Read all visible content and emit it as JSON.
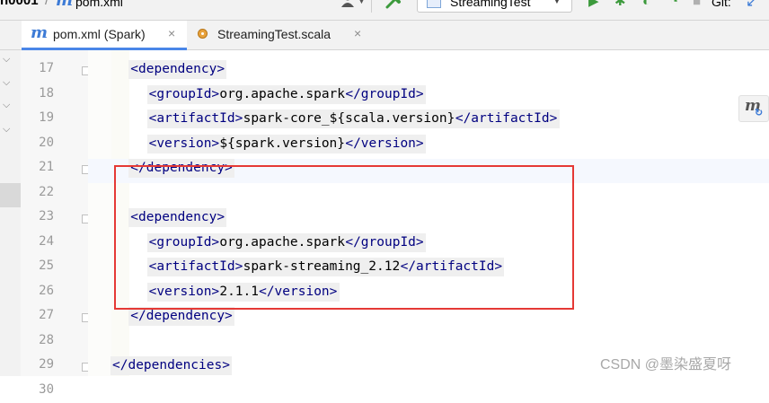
{
  "breadcrumb": {
    "project": "n0001",
    "separator": "/",
    "file": "pom.xml"
  },
  "toolbar": {
    "run_config_label": "StreamingTest",
    "git_label": "Git:"
  },
  "tabs": [
    {
      "label": "pom.xml (Spark)",
      "close": "×",
      "active": true
    },
    {
      "label": "StreamingTest.scala",
      "close": "×",
      "active": false
    }
  ],
  "editor": {
    "lines": [
      {
        "num": "17",
        "indent": 2,
        "segments": [
          [
            "tag",
            "<dependency>"
          ]
        ]
      },
      {
        "num": "18",
        "indent": 3,
        "segments": [
          [
            "tag",
            "<groupId>"
          ],
          [
            "txt",
            "org.apache.spark"
          ],
          [
            "tag",
            "</groupId>"
          ]
        ]
      },
      {
        "num": "19",
        "indent": 3,
        "segments": [
          [
            "tag",
            "<artifactId>"
          ],
          [
            "txt",
            "spark-core_${scala.version}"
          ],
          [
            "tag",
            "</artifactId>"
          ]
        ]
      },
      {
        "num": "20",
        "indent": 3,
        "segments": [
          [
            "tag",
            "<version>"
          ],
          [
            "txt",
            "${spark.version}"
          ],
          [
            "tag",
            "</version>"
          ]
        ]
      },
      {
        "num": "21",
        "indent": 2,
        "segments": [
          [
            "tag",
            "</dependency>"
          ]
        ]
      },
      {
        "num": "22",
        "indent": 0,
        "segments": []
      },
      {
        "num": "23",
        "indent": 2,
        "segments": [
          [
            "tag",
            "<dependency>"
          ]
        ]
      },
      {
        "num": "24",
        "indent": 3,
        "segments": [
          [
            "tag",
            "<groupId>"
          ],
          [
            "txt",
            "org.apache.spark"
          ],
          [
            "tag",
            "</groupId>"
          ]
        ]
      },
      {
        "num": "25",
        "indent": 3,
        "segments": [
          [
            "tag",
            "<artifactId>"
          ],
          [
            "txt",
            "spark-streaming_2.12"
          ],
          [
            "tag",
            "</artifactId>"
          ]
        ]
      },
      {
        "num": "26",
        "indent": 3,
        "segments": [
          [
            "tag",
            "<version>"
          ],
          [
            "txt",
            "2.1.1"
          ],
          [
            "tag",
            "</version>"
          ]
        ]
      },
      {
        "num": "27",
        "indent": 2,
        "segments": [
          [
            "tag",
            "</dependency>"
          ]
        ]
      },
      {
        "num": "28",
        "indent": 0,
        "segments": []
      },
      {
        "num": "29",
        "indent": 1,
        "segments": [
          [
            "tag",
            "</dependencies>"
          ]
        ]
      },
      {
        "num": "30",
        "indent": 0,
        "segments": []
      }
    ]
  },
  "colors": {
    "tag": "#000080",
    "text": "#000000",
    "highlight_box": "#e53935",
    "active_tab_underline": "#4a86e8"
  },
  "watermark": "CSDN @墨染盛夏呀"
}
